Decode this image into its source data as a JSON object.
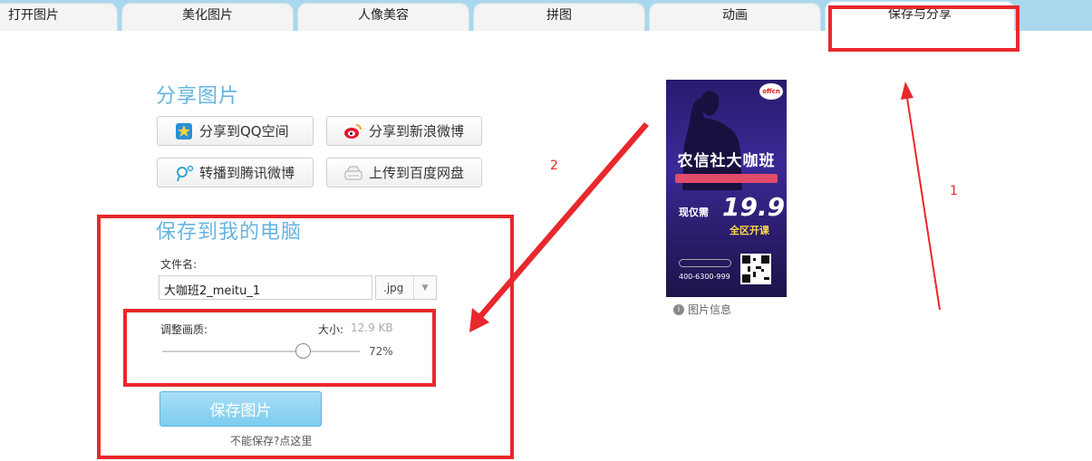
{
  "tabs": [
    {
      "label": "打开图片"
    },
    {
      "label": "美化图片"
    },
    {
      "label": "人像美容"
    },
    {
      "label": "拼图"
    },
    {
      "label": "动画"
    },
    {
      "label": "保存与分享"
    }
  ],
  "share": {
    "title": "分享图片",
    "buttons": [
      {
        "label": "分享到QQ空间",
        "icon": "qzone-star-icon"
      },
      {
        "label": "分享到新浪微博",
        "icon": "weibo-icon"
      },
      {
        "label": "转播到腾讯微博",
        "icon": "tencent-weibo-icon"
      },
      {
        "label": "上传到百度网盘",
        "icon": "cloud-disk-icon"
      }
    ]
  },
  "save": {
    "title": "保存到我的电脑",
    "filename_label": "文件名:",
    "filename_value": "大咖班2_meitu_1",
    "extension": ".jpg",
    "quality_label": "调整画质:",
    "size_label": "大小:",
    "size_value": "12.9 KB",
    "quality_percent": "72%",
    "quality_value": 0.72,
    "save_button": "保存图片",
    "help_link": "不能保存?点这里"
  },
  "poster": {
    "logo": "offcn",
    "title": "农信社大咖班",
    "now_price_label": "现仅需",
    "price": "19.9",
    "region": "全区开课",
    "phone": "400-6300-999"
  },
  "image_info": "图片信息",
  "annotations": {
    "one": "1",
    "two": "2"
  },
  "colors": {
    "annotation": "#e8282c",
    "accent": "#66b4de",
    "tabbar": "#a9d8ee"
  }
}
